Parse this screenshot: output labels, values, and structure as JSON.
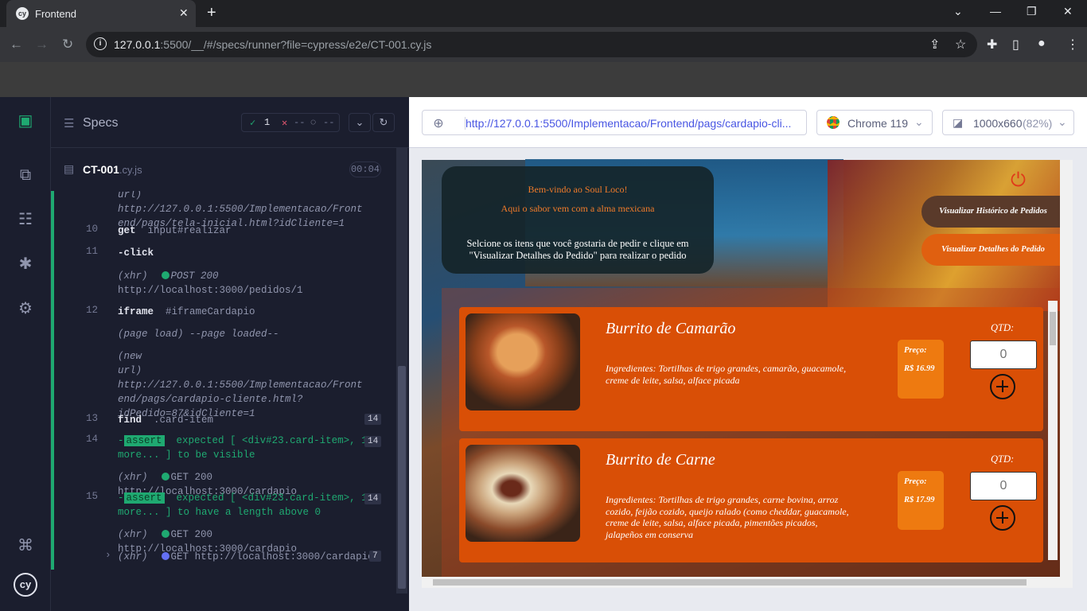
{
  "browser": {
    "tab_title": "Frontend",
    "url_host": "127.0.0.1",
    "url_rest": ":5500/__/#/specs/runner?file=cypress/e2e/CT-001.cy.js"
  },
  "runner": {
    "specs_label": "Specs",
    "passed": "1",
    "failed": "--",
    "pending": "--",
    "spec_name": "CT-001",
    "spec_ext": ".cy.js",
    "duration": "00:04",
    "commands": [
      {
        "n": "",
        "l1": "url)  http://127.0.0.1:5500/Implementacao/Front",
        "l2": "end/pags/tela-inicial.html?idCliente=1"
      },
      {
        "n": "10",
        "cmd": "get",
        "arg": "input#realizar"
      },
      {
        "n": "11",
        "cmd": "-click"
      },
      {
        "n": "",
        "xhr": "(xhr)",
        "method": "POST 200",
        "url": "http://localhost:3000/pedidos/1"
      },
      {
        "n": "12",
        "cmd": "iframe",
        "arg": "#iframeCardapio"
      },
      {
        "n": "",
        "text": "(page load)  --page loaded--"
      },
      {
        "n": "",
        "l0": "(new",
        "l1": "url)  http://127.0.0.1:5500/Implementacao/Front",
        "l2": "end/pags/cardapio-cliente.html?",
        "l3": "idPedido=87&idCliente=1"
      },
      {
        "n": "13",
        "cmd": "find",
        "arg": ".card-item",
        "count": "14"
      },
      {
        "n": "14",
        "badge": "assert",
        "a1": "expected [ <div#23.card-item>, 13",
        "a2": "more... ] to be visible",
        "count": "14"
      },
      {
        "n": "",
        "xhr": "(xhr)",
        "method": "GET 200",
        "url": "http://localhost:3000/cardapio"
      },
      {
        "n": "15",
        "badge": "assert",
        "a1": "expected [ <div#23.card-item>, 13",
        "a2": "more... ] to have a length above 0",
        "count": "14"
      },
      {
        "n": "",
        "xhr": "(xhr)",
        "method": "GET 200",
        "url": "http://localhost:3000/cardapio"
      },
      {
        "n": "",
        "xhr": "(xhr)",
        "method": "GET",
        "url": "http://localhost:3000/cardapio",
        "count": "7"
      }
    ]
  },
  "aut_header": {
    "url": "http://127.0.0.1:5500/Implementacao/Frontend/pags/cardapio-cli...",
    "browser": "Chrome 119",
    "viewport": "1000x660",
    "scale": "(82%)"
  },
  "app": {
    "welcome1": "Bem-vindo ao Soul Loco!",
    "welcome2": "Aqui o sabor vem com a alma mexicana",
    "instructions": "Selcione os itens que você gostaria de pedir e clique em \"Visualizar Detalhes do Pedido\" para realizar o pedido",
    "btn_history": "Visualizar Histórico de Pedidos",
    "btn_details": "Visualizar Detalhes do Pedido",
    "items": [
      {
        "name": "Burrito de Camarão",
        "ingredients": "Ingredientes: Tortilhas de trigo grandes, camarão, guacamole, creme de leite, salsa, alface picada",
        "price_label": "Preço:",
        "price": "R$ 16.99",
        "qty_label": "QTD:",
        "qty": "0"
      },
      {
        "name": "Burrito de Carne",
        "ingredients": "Ingredientes: Tortilhas de trigo grandes, carne bovina, arroz cozido, feijão cozido, queijo ralado (como cheddar, guacamole, creme de leite, salsa, alface picada, pimentões picados, jalapeños em conserva",
        "price_label": "Preço:",
        "price": "R$ 17.99",
        "qty_label": "QTD:",
        "qty": "0"
      }
    ]
  }
}
